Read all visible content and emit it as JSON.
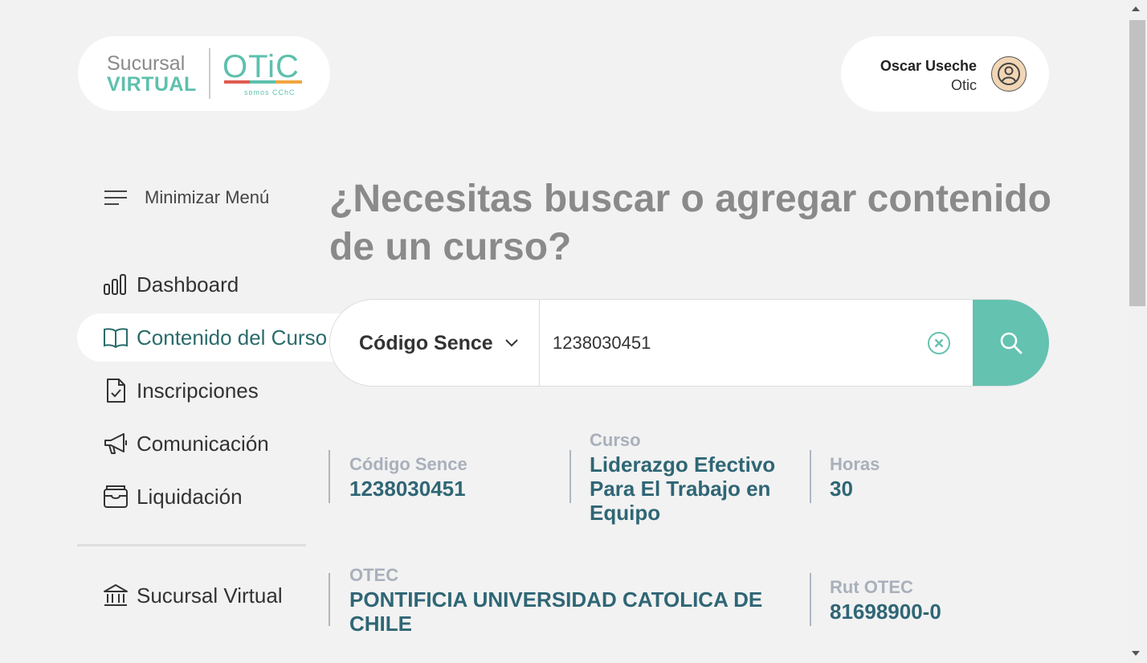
{
  "logo": {
    "line1": "Sucursal",
    "line2": "VIRTUAL",
    "brand": "OTiC",
    "tagline": "somos CChC"
  },
  "user": {
    "name": "Oscar Useche",
    "role": "Otic"
  },
  "sidebar": {
    "toggle_label": "Minimizar Menú",
    "items": [
      {
        "label": "Dashboard",
        "icon": "bar-chart-icon"
      },
      {
        "label": "Contenido del Curso",
        "icon": "book-icon",
        "active": true
      },
      {
        "label": "Inscripciones",
        "icon": "file-check-icon"
      },
      {
        "label": "Comunicación",
        "icon": "megaphone-icon"
      },
      {
        "label": "Liquidación",
        "icon": "wallet-icon"
      }
    ],
    "footer_item": {
      "label": "Sucursal Virtual",
      "icon": "bank-icon"
    }
  },
  "main": {
    "heading": "¿Necesitas buscar o agregar contenido de un curso?",
    "search": {
      "filter_label": "Código Sence",
      "value": "1238030451"
    },
    "result": {
      "codigo_label": "Código Sence",
      "codigo_value": "1238030451",
      "curso_label": "Curso",
      "curso_value": "Liderazgo Efectivo Para El Trabajo en Equipo",
      "horas_label": "Horas",
      "horas_value": "30",
      "otec_label": "OTEC",
      "otec_value": "PONTIFICIA UNIVERSIDAD CATOLICA DE CHILE",
      "rut_label": "Rut OTEC",
      "rut_value": "81698900-0"
    }
  },
  "colors": {
    "accent": "#64c2b0",
    "result_value": "#2f6675",
    "active_nav": "#2b6b6b",
    "background": "#f2f2f2"
  }
}
